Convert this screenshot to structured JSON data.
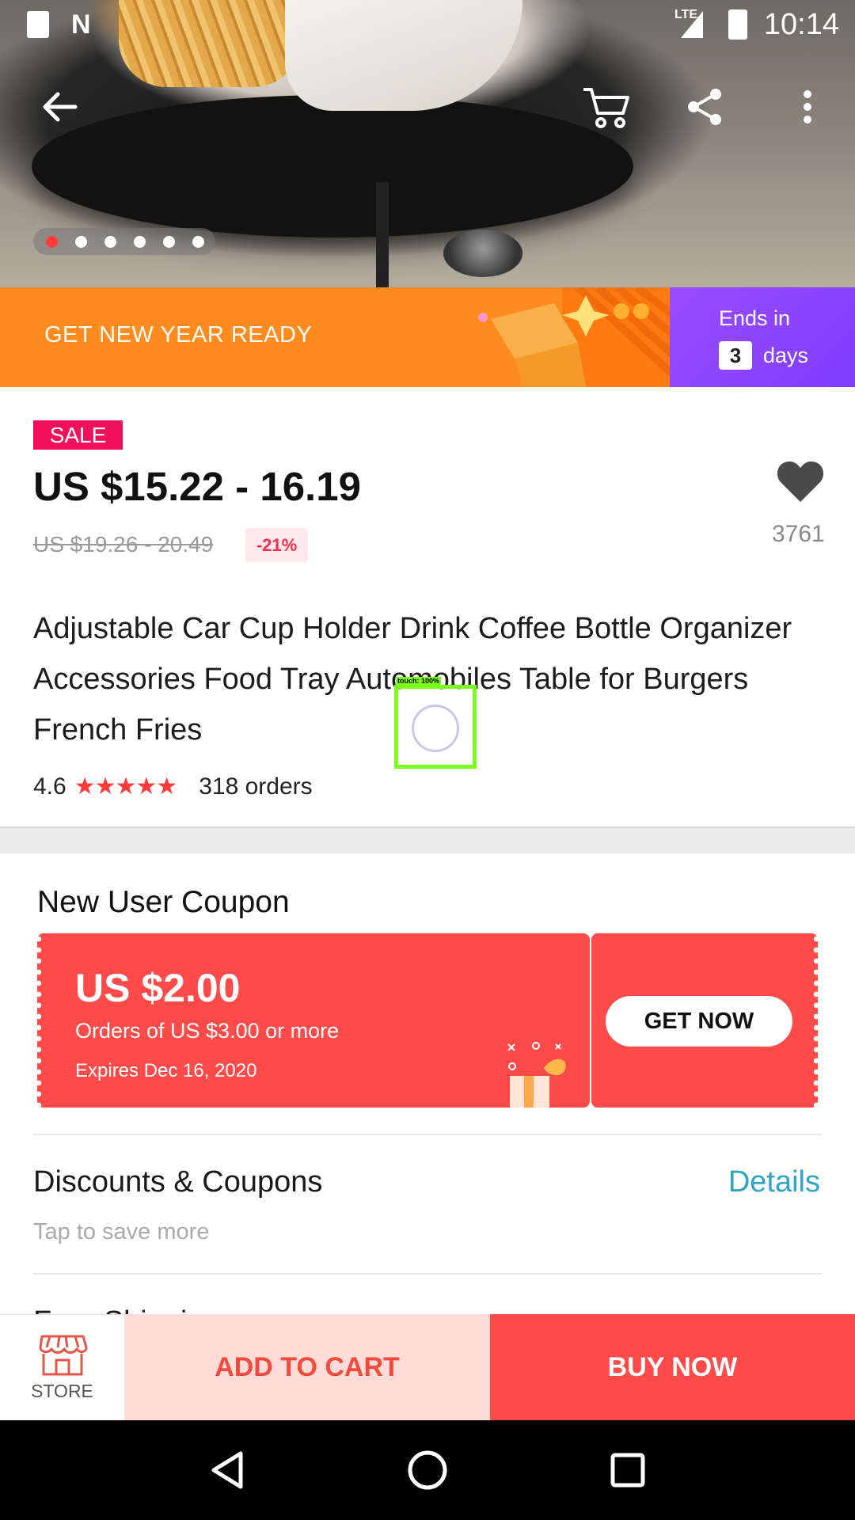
{
  "status_bar": {
    "time": "10:14",
    "network": "LTE",
    "icons": [
      "sd-card-icon",
      "n-notification-icon",
      "signal-icon",
      "battery-charging-icon"
    ]
  },
  "top_bar": {
    "icons": [
      "back-arrow-icon",
      "cart-icon",
      "share-icon",
      "more-vert-icon"
    ]
  },
  "gallery": {
    "image_count": 6,
    "active_index": 0
  },
  "promo": {
    "text": "GET NEW YEAR READY",
    "ends_label": "Ends in",
    "days_value": "3",
    "days_label": "days",
    "colors": {
      "left": "#ff8a1e",
      "right": "#8a44ff"
    }
  },
  "product": {
    "badge": "SALE",
    "price": "US $15.22 - 16.19",
    "original_price": "US $19.26 - 20.49",
    "discount": "-21%",
    "wishlist_count": "3761",
    "title": "Adjustable Car Cup Holder Drink Coffee Bottle Organizer Accessories Food Tray Automobiles Table for Burgers French Fries",
    "rating": "4.6",
    "stars": "★★★★★",
    "orders": "318 orders"
  },
  "touch_indicator": {
    "label": "touch: 100%"
  },
  "coupon": {
    "heading": "New User Coupon",
    "amount": "US $2.00",
    "min_order": "Orders of US $3.00 or more",
    "expires": "Expires Dec 16, 2020",
    "cta": "GET NOW",
    "color": "#ff4a4a"
  },
  "discounts": {
    "title": "Discounts & Coupons",
    "subtitle": "Tap to save more",
    "link": "Details"
  },
  "next_section_peek": "Free Shipping",
  "action_bar": {
    "store_label": "STORE",
    "add_to_cart": "ADD TO CART",
    "buy_now": "BUY NOW"
  },
  "nav_bar": {
    "icons": [
      "back-triangle-icon",
      "home-circle-icon",
      "recents-square-icon"
    ]
  }
}
